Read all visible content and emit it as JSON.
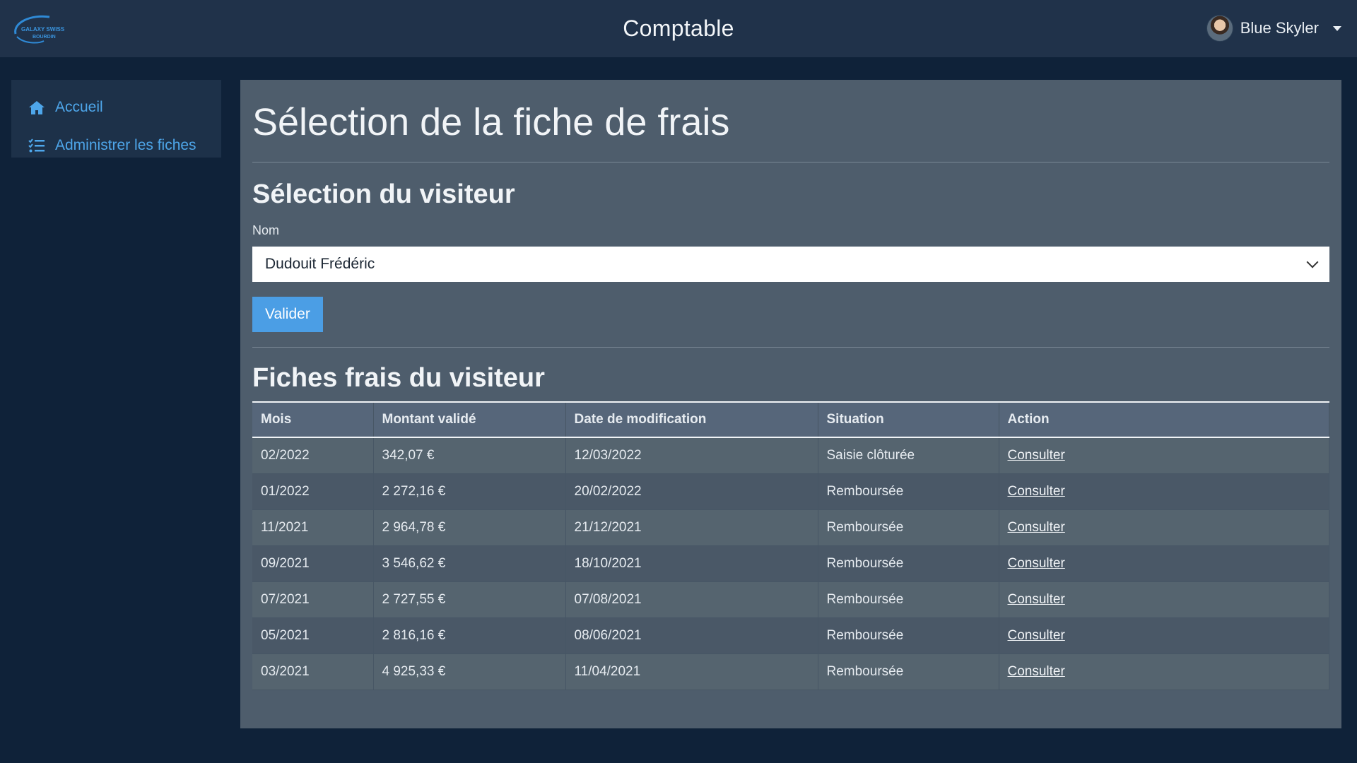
{
  "brand": {
    "logo_text_line1": "GALAXY SWISS",
    "logo_text_line2": "BOURDIN",
    "title": "Comptable"
  },
  "user": {
    "name": "Blue Skyler",
    "avatar_icon": "user-avatar"
  },
  "sidebar": {
    "items": [
      {
        "label": "Accueil",
        "icon": "home-icon"
      },
      {
        "label": "Administrer les fiches",
        "icon": "list-check-icon"
      }
    ]
  },
  "main": {
    "page_title": "Sélection de la fiche de frais",
    "visitor_section_title": "Sélection du visiteur",
    "name_label": "Nom",
    "selected_visitor": "Dudouit Frédéric",
    "submit_label": "Valider",
    "table_section_title": "Fiches frais du visiteur",
    "table": {
      "headers": [
        "Mois",
        "Montant validé",
        "Date de modification",
        "Situation",
        "Action"
      ],
      "rows": [
        [
          "02/2022",
          "342,07 €",
          "12/03/2022",
          "Saisie clôturée",
          "Consulter"
        ],
        [
          "01/2022",
          "2 272,16 €",
          "20/02/2022",
          "Remboursée",
          "Consulter"
        ],
        [
          "11/2021",
          "2 964,78 €",
          "21/12/2021",
          "Remboursée",
          "Consulter"
        ],
        [
          "09/2021",
          "3 546,62 €",
          "18/10/2021",
          "Remboursée",
          "Consulter"
        ],
        [
          "07/2021",
          "2 727,55 €",
          "07/08/2021",
          "Remboursée",
          "Consulter"
        ],
        [
          "05/2021",
          "2 816,16 €",
          "08/06/2021",
          "Remboursée",
          "Consulter"
        ],
        [
          "03/2021",
          "4 925,33 €",
          "11/04/2021",
          "Remboursée",
          "Consulter"
        ]
      ]
    }
  },
  "colors": {
    "background": "#0f2239",
    "navbar": "#20324a",
    "panel": "#4e5d6c",
    "accent": "#4b9ee5",
    "link": "#4ea6ea"
  }
}
